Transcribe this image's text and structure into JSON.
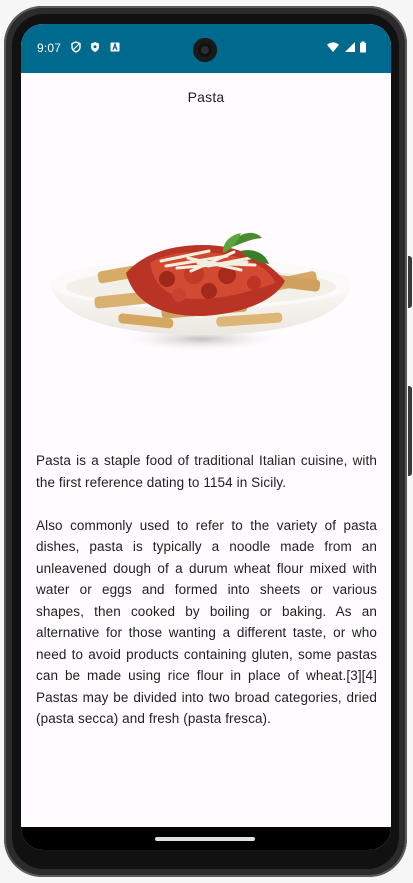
{
  "status_bar": {
    "time": "9:07",
    "background_color": "#006a8e",
    "left_icons": [
      "shield-outline-icon",
      "shield-filled-icon",
      "text-a-icon"
    ],
    "right_icons": [
      "wifi-icon",
      "cellular-signal-icon",
      "battery-icon"
    ]
  },
  "page": {
    "title": "Pasta",
    "image_alt": "pasta-dish-image",
    "paragraphs": [
      "Pasta is a staple food of traditional Italian cuisine, with the first reference dating to 1154 in Sicily.",
      "Also commonly used to refer to the variety of pasta dishes, pasta is typically a noodle made from an unleavened dough of a durum wheat flour mixed with water or eggs and formed into sheets or various shapes, then cooked by boiling or baking. As an alternative for those wanting a different taste, or who need to avoid products containing gluten, some pastas can be made using rice flour in place of wheat.[3][4] Pastas may be divided into two broad categories, dried (pasta secca) and fresh (pasta fresca)."
    ]
  },
  "navigation": {
    "home_indicator": "home-indicator"
  }
}
